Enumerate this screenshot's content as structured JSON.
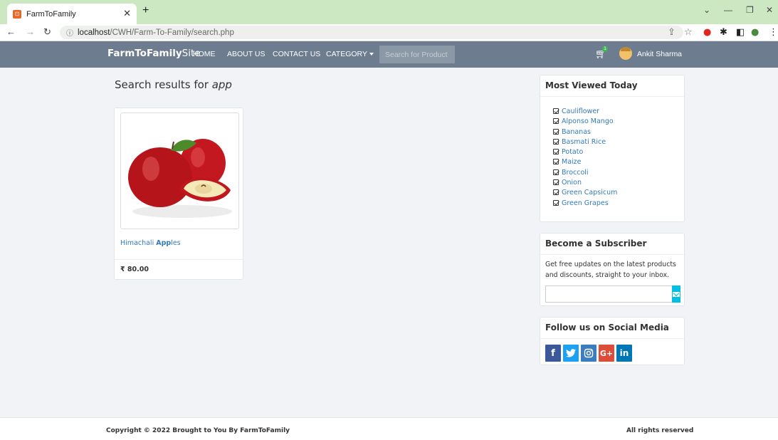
{
  "browser": {
    "tab_title": "FarmToFamily",
    "url_host": "localhost",
    "url_path": "/CWH/Farm-To-Family/search.php"
  },
  "navbar": {
    "brand_bold": "FarmToFamily",
    "brand_rest": "Site",
    "links": [
      "HOME",
      "ABOUT US",
      "CONTACT US",
      "CATEGORY"
    ],
    "search_placeholder": "Search for Product",
    "cart_count": "1",
    "user_name": "Ankit Sharma"
  },
  "results": {
    "heading_prefix": "Search results for ",
    "query": "app"
  },
  "product": {
    "name_before": "Himachali ",
    "name_match": "App",
    "name_after": "les",
    "price": "₹ 80.00"
  },
  "most_viewed": {
    "title": "Most Viewed Today",
    "items": [
      "Cauliflower",
      "Alponso Mango",
      "Bananas",
      "Basmati Rice",
      "Potato",
      "Maize",
      "Broccoli",
      "Onion",
      "Green Capsicum",
      "Green Grapes"
    ]
  },
  "subscribe": {
    "title": "Become a Subscriber",
    "text": "Get free updates on the latest products and discounts, straight to your inbox."
  },
  "social": {
    "title": "Follow us on Social Media",
    "colors": {
      "facebook": "#3b5998",
      "twitter": "#1da1f2",
      "instagram": "#3b7bbf",
      "google": "#dd4b39",
      "linkedin": "#0077b5"
    }
  },
  "footer": {
    "copyright": "Copyright © 2022 Brought to You By FarmToFamily",
    "rights": "All rights reserved"
  }
}
